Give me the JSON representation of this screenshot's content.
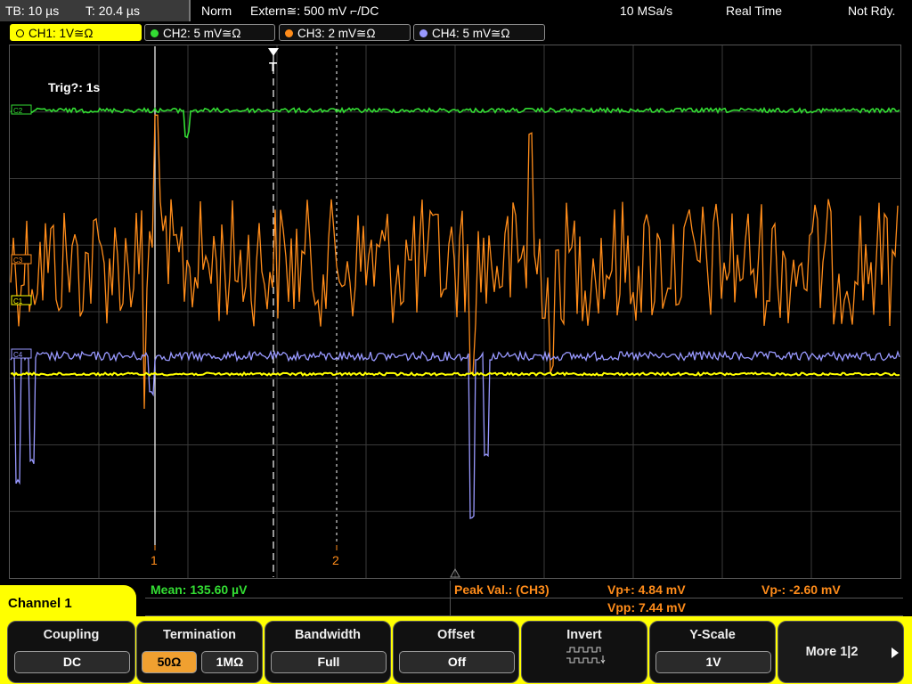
{
  "status": {
    "timebase": "TB: 10 µs",
    "trigger_time": "T: 20.4 µs",
    "mode": "Norm",
    "trigger_source": "Extern≅: 500 mV ⌐/DC",
    "sample_rate": "10 MSa/s",
    "acq_mode": "Real Time",
    "state": "Not Rdy."
  },
  "channels": [
    {
      "label": "CH1: 1V≅Ω",
      "color": "#ffff00",
      "active": true
    },
    {
      "label": "CH2: 5 mV≅Ω",
      "color": "#33dd33",
      "active": false
    },
    {
      "label": "CH3: 2 mV≅Ω",
      "color": "#ff8c1a",
      "active": false
    },
    {
      "label": "CH4: 5 mV≅Ω",
      "color": "#9999ff",
      "active": false
    }
  ],
  "screen": {
    "trig_text": "Trig?: 1s",
    "marker1_label": "1",
    "marker2_label": "2",
    "ch1_marker": "C1",
    "ch2_marker": "C2",
    "ch3_marker": "C3",
    "ch4_marker": "C4"
  },
  "info": {
    "mean": "Mean: 135.60 µV",
    "peak_label": "Peak Val.: (CH3)",
    "vp_plus": "Vp+: 4.84 mV",
    "vp_minus": "Vp-: -2.60 mV",
    "vpp": "Vpp: 7.44 mV"
  },
  "menu": {
    "title": "Channel 1",
    "coupling_title": "Coupling",
    "coupling_value": "DC",
    "termination_title": "Termination",
    "termination_opt1": "50Ω",
    "termination_opt2": "1MΩ",
    "bandwidth_title": "Bandwidth",
    "bandwidth_value": "Full",
    "offset_title": "Offset",
    "offset_value": "Off",
    "invert_title": "Invert",
    "yscale_title": "Y-Scale",
    "yscale_value": "1V",
    "more_label": "More 1|2"
  }
}
